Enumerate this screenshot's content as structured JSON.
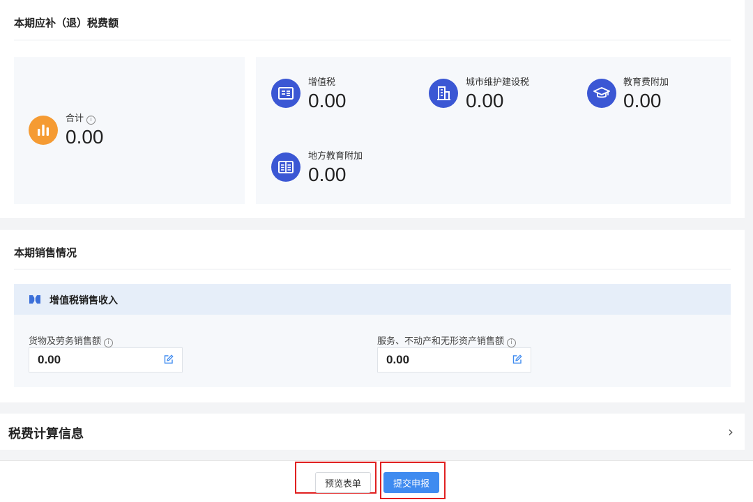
{
  "tax_section": {
    "title": "本期应补（退）税费额",
    "total": {
      "label": "合计",
      "info_glyph": "i",
      "value": "0.00",
      "icon": "bar-chart-icon"
    },
    "items": [
      {
        "label": "增值税",
        "value": "0.00",
        "icon": "tax-form-icon"
      },
      {
        "label": "城市维护建设税",
        "value": "0.00",
        "icon": "building-icon"
      },
      {
        "label": "教育费附加",
        "value": "0.00",
        "icon": "graduation-cap-icon"
      },
      {
        "label": "地方教育附加",
        "value": "0.00",
        "icon": "book-icon"
      }
    ]
  },
  "sales_section": {
    "title": "本期销售情况",
    "vat_income": {
      "title": "增值税销售收入",
      "goods": {
        "label": "货物及劳务销售额",
        "value": "0.00"
      },
      "services": {
        "label": "服务、不动产和无形资产销售额",
        "value": "0.00"
      }
    }
  },
  "calc_section": {
    "title": "税费计算信息",
    "chevron": "›"
  },
  "footer": {
    "preview_label": "预览表单",
    "submit_label": "提交申报"
  },
  "colors": {
    "accent_blue": "#3b57d4",
    "accent_orange": "#f59b33",
    "primary_button": "#3f8bf0",
    "highlight_red": "#e02020"
  }
}
